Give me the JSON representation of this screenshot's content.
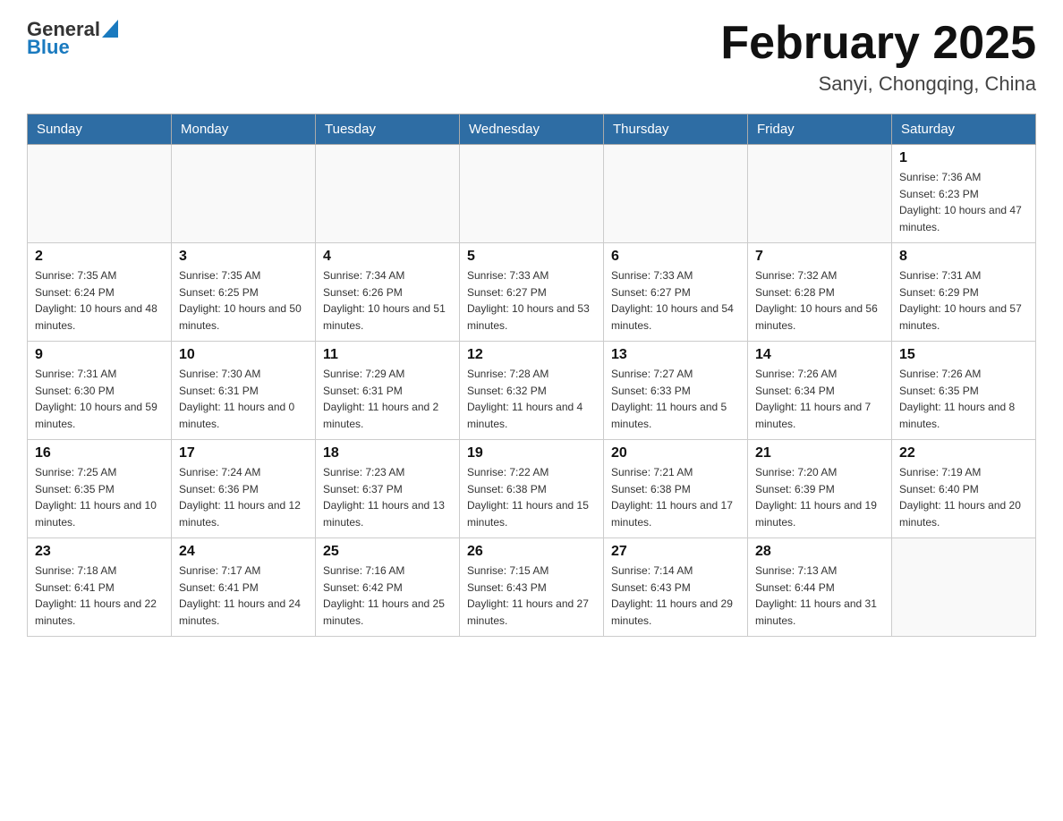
{
  "logo": {
    "text_general": "General",
    "text_blue": "Blue"
  },
  "header": {
    "month_year": "February 2025",
    "location": "Sanyi, Chongqing, China"
  },
  "days_of_week": [
    "Sunday",
    "Monday",
    "Tuesday",
    "Wednesday",
    "Thursday",
    "Friday",
    "Saturday"
  ],
  "weeks": [
    [
      {
        "day": "",
        "sunrise": "",
        "sunset": "",
        "daylight": ""
      },
      {
        "day": "",
        "sunrise": "",
        "sunset": "",
        "daylight": ""
      },
      {
        "day": "",
        "sunrise": "",
        "sunset": "",
        "daylight": ""
      },
      {
        "day": "",
        "sunrise": "",
        "sunset": "",
        "daylight": ""
      },
      {
        "day": "",
        "sunrise": "",
        "sunset": "",
        "daylight": ""
      },
      {
        "day": "",
        "sunrise": "",
        "sunset": "",
        "daylight": ""
      },
      {
        "day": "1",
        "sunrise": "Sunrise: 7:36 AM",
        "sunset": "Sunset: 6:23 PM",
        "daylight": "Daylight: 10 hours and 47 minutes."
      }
    ],
    [
      {
        "day": "2",
        "sunrise": "Sunrise: 7:35 AM",
        "sunset": "Sunset: 6:24 PM",
        "daylight": "Daylight: 10 hours and 48 minutes."
      },
      {
        "day": "3",
        "sunrise": "Sunrise: 7:35 AM",
        "sunset": "Sunset: 6:25 PM",
        "daylight": "Daylight: 10 hours and 50 minutes."
      },
      {
        "day": "4",
        "sunrise": "Sunrise: 7:34 AM",
        "sunset": "Sunset: 6:26 PM",
        "daylight": "Daylight: 10 hours and 51 minutes."
      },
      {
        "day": "5",
        "sunrise": "Sunrise: 7:33 AM",
        "sunset": "Sunset: 6:27 PM",
        "daylight": "Daylight: 10 hours and 53 minutes."
      },
      {
        "day": "6",
        "sunrise": "Sunrise: 7:33 AM",
        "sunset": "Sunset: 6:27 PM",
        "daylight": "Daylight: 10 hours and 54 minutes."
      },
      {
        "day": "7",
        "sunrise": "Sunrise: 7:32 AM",
        "sunset": "Sunset: 6:28 PM",
        "daylight": "Daylight: 10 hours and 56 minutes."
      },
      {
        "day": "8",
        "sunrise": "Sunrise: 7:31 AM",
        "sunset": "Sunset: 6:29 PM",
        "daylight": "Daylight: 10 hours and 57 minutes."
      }
    ],
    [
      {
        "day": "9",
        "sunrise": "Sunrise: 7:31 AM",
        "sunset": "Sunset: 6:30 PM",
        "daylight": "Daylight: 10 hours and 59 minutes."
      },
      {
        "day": "10",
        "sunrise": "Sunrise: 7:30 AM",
        "sunset": "Sunset: 6:31 PM",
        "daylight": "Daylight: 11 hours and 0 minutes."
      },
      {
        "day": "11",
        "sunrise": "Sunrise: 7:29 AM",
        "sunset": "Sunset: 6:31 PM",
        "daylight": "Daylight: 11 hours and 2 minutes."
      },
      {
        "day": "12",
        "sunrise": "Sunrise: 7:28 AM",
        "sunset": "Sunset: 6:32 PM",
        "daylight": "Daylight: 11 hours and 4 minutes."
      },
      {
        "day": "13",
        "sunrise": "Sunrise: 7:27 AM",
        "sunset": "Sunset: 6:33 PM",
        "daylight": "Daylight: 11 hours and 5 minutes."
      },
      {
        "day": "14",
        "sunrise": "Sunrise: 7:26 AM",
        "sunset": "Sunset: 6:34 PM",
        "daylight": "Daylight: 11 hours and 7 minutes."
      },
      {
        "day": "15",
        "sunrise": "Sunrise: 7:26 AM",
        "sunset": "Sunset: 6:35 PM",
        "daylight": "Daylight: 11 hours and 8 minutes."
      }
    ],
    [
      {
        "day": "16",
        "sunrise": "Sunrise: 7:25 AM",
        "sunset": "Sunset: 6:35 PM",
        "daylight": "Daylight: 11 hours and 10 minutes."
      },
      {
        "day": "17",
        "sunrise": "Sunrise: 7:24 AM",
        "sunset": "Sunset: 6:36 PM",
        "daylight": "Daylight: 11 hours and 12 minutes."
      },
      {
        "day": "18",
        "sunrise": "Sunrise: 7:23 AM",
        "sunset": "Sunset: 6:37 PM",
        "daylight": "Daylight: 11 hours and 13 minutes."
      },
      {
        "day": "19",
        "sunrise": "Sunrise: 7:22 AM",
        "sunset": "Sunset: 6:38 PM",
        "daylight": "Daylight: 11 hours and 15 minutes."
      },
      {
        "day": "20",
        "sunrise": "Sunrise: 7:21 AM",
        "sunset": "Sunset: 6:38 PM",
        "daylight": "Daylight: 11 hours and 17 minutes."
      },
      {
        "day": "21",
        "sunrise": "Sunrise: 7:20 AM",
        "sunset": "Sunset: 6:39 PM",
        "daylight": "Daylight: 11 hours and 19 minutes."
      },
      {
        "day": "22",
        "sunrise": "Sunrise: 7:19 AM",
        "sunset": "Sunset: 6:40 PM",
        "daylight": "Daylight: 11 hours and 20 minutes."
      }
    ],
    [
      {
        "day": "23",
        "sunrise": "Sunrise: 7:18 AM",
        "sunset": "Sunset: 6:41 PM",
        "daylight": "Daylight: 11 hours and 22 minutes."
      },
      {
        "day": "24",
        "sunrise": "Sunrise: 7:17 AM",
        "sunset": "Sunset: 6:41 PM",
        "daylight": "Daylight: 11 hours and 24 minutes."
      },
      {
        "day": "25",
        "sunrise": "Sunrise: 7:16 AM",
        "sunset": "Sunset: 6:42 PM",
        "daylight": "Daylight: 11 hours and 25 minutes."
      },
      {
        "day": "26",
        "sunrise": "Sunrise: 7:15 AM",
        "sunset": "Sunset: 6:43 PM",
        "daylight": "Daylight: 11 hours and 27 minutes."
      },
      {
        "day": "27",
        "sunrise": "Sunrise: 7:14 AM",
        "sunset": "Sunset: 6:43 PM",
        "daylight": "Daylight: 11 hours and 29 minutes."
      },
      {
        "day": "28",
        "sunrise": "Sunrise: 7:13 AM",
        "sunset": "Sunset: 6:44 PM",
        "daylight": "Daylight: 11 hours and 31 minutes."
      },
      {
        "day": "",
        "sunrise": "",
        "sunset": "",
        "daylight": ""
      }
    ]
  ]
}
